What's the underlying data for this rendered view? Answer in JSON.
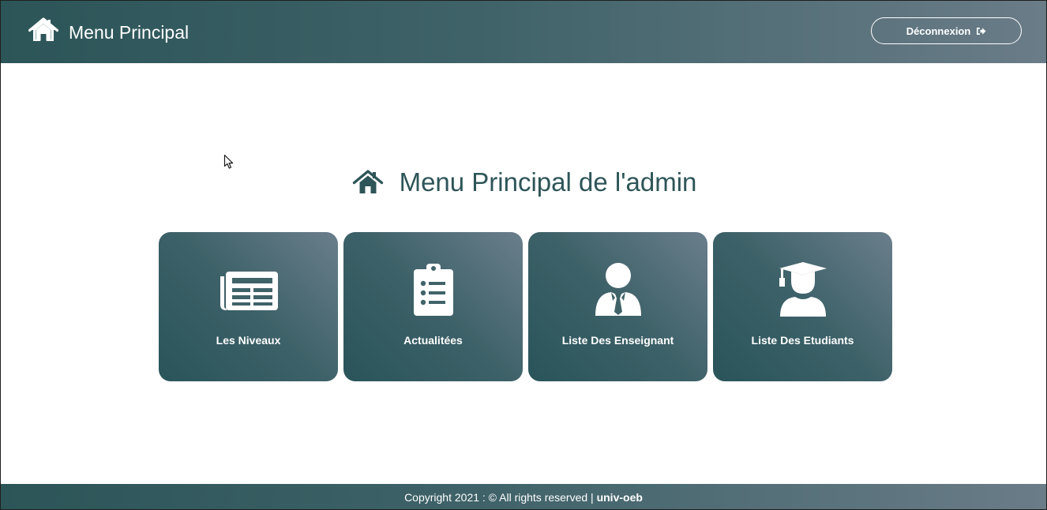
{
  "header": {
    "title": "Menu Principal",
    "home_icon": "home-icon",
    "logout_label": "Déconnexion",
    "logout_icon": "sign-out-icon"
  },
  "main": {
    "heading": "Menu Principal de l'admin",
    "heading_icon": "home-icon",
    "cards": [
      {
        "label": "Les Niveaux",
        "icon": "newspaper-icon"
      },
      {
        "label": "Actualitées",
        "icon": "clipboard-list-icon"
      },
      {
        "label": "Liste Des Enseignant",
        "icon": "user-tie-icon"
      },
      {
        "label": "Liste Des Etudiants",
        "icon": "graduate-icon"
      }
    ]
  },
  "footer": {
    "copyright": "Copyright 2021 : © All rights reserved |",
    "brand": "univ-oeb"
  },
  "colors": {
    "bar_dark": "#2c5558",
    "bar_light": "#6a7c88",
    "heading": "#2e5558",
    "text_on_bar": "#ffffff"
  }
}
